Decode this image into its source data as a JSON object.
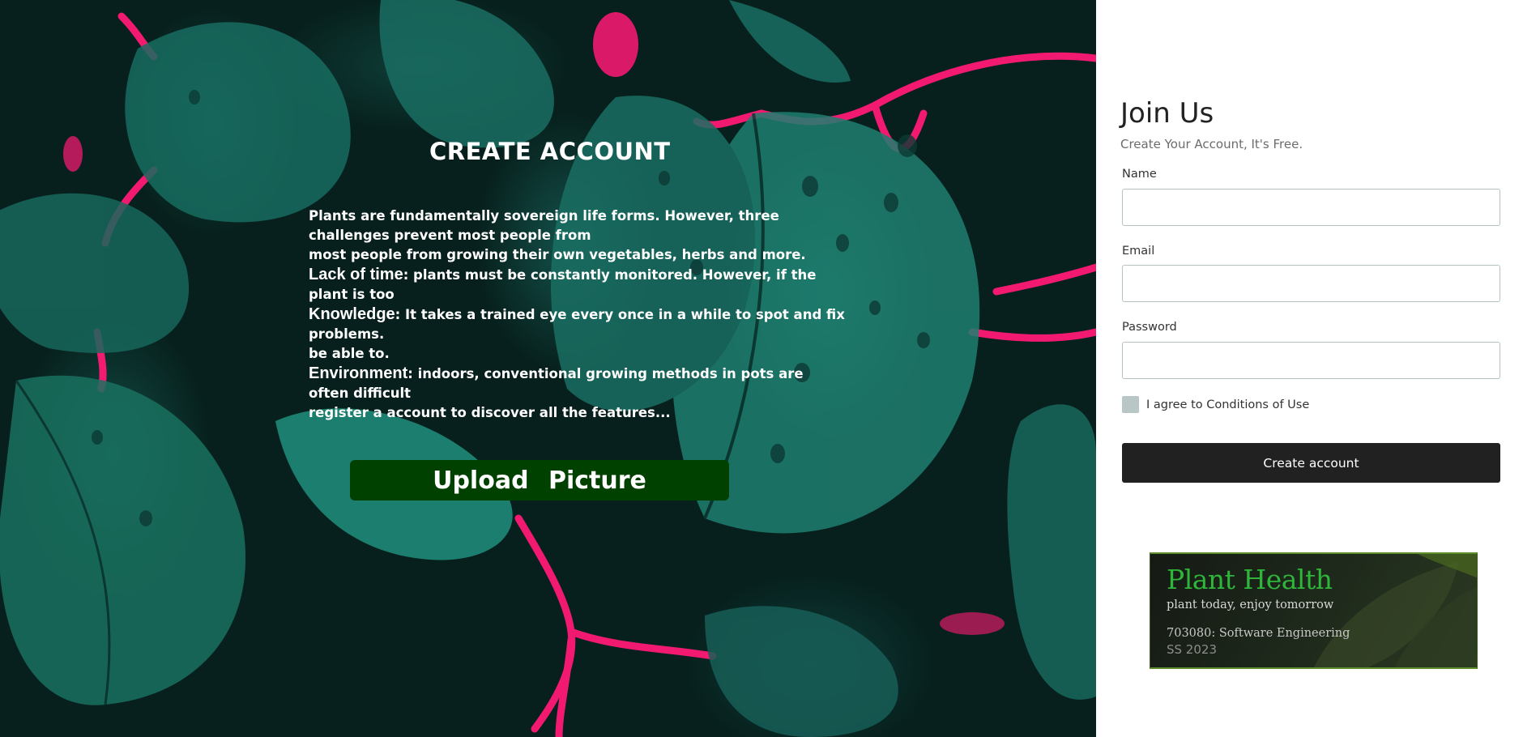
{
  "hero": {
    "title": "CREATE ACCOUNT",
    "lines": [
      {
        "text": "Plants are fundamentally sovereign life forms. However, three"
      },
      {
        "text": "challenges prevent most people from"
      },
      {
        "text": "most people from growing their own vegetables, herbs and more."
      },
      {
        "keyword": "Lack of time",
        "text": ": plants must be constantly monitored. However, if the"
      },
      {
        "text": "plant is too"
      },
      {
        "keyword": "Knowledge",
        "text": ": It takes a trained eye every once in a while to spot and fix"
      },
      {
        "text": "problems."
      },
      {
        "text": "be able to."
      },
      {
        "keyword": "Environment",
        "text": ": indoors, conventional growing methods in pots are"
      },
      {
        "text": "often difficult"
      },
      {
        "text": "register a account to discover all the features..."
      }
    ],
    "upload_label": "Upload Picture",
    "colors": {
      "upload_bg": "#004100",
      "stem": "#ff1a75",
      "leaf": "#1f8f7d"
    }
  },
  "form": {
    "title": "Join Us",
    "subtitle": "Create Your Account, It's Free.",
    "name_label": "Name",
    "name_value": "",
    "email_label": "Email",
    "email_value": "",
    "password_label": "Password",
    "password_value": "",
    "agree_label": "I agree to Conditions of Use",
    "agree_checked": false,
    "submit_label": "Create account",
    "colors": {
      "button_bg": "#212121",
      "checkbox": "#b8c6c6"
    }
  },
  "promo": {
    "title": "Plant Health",
    "tagline": "plant today, enjoy tomorrow",
    "course": "703080: Software Engineering",
    "term": "SS 2023",
    "colors": {
      "title": "#2fb53a"
    }
  }
}
